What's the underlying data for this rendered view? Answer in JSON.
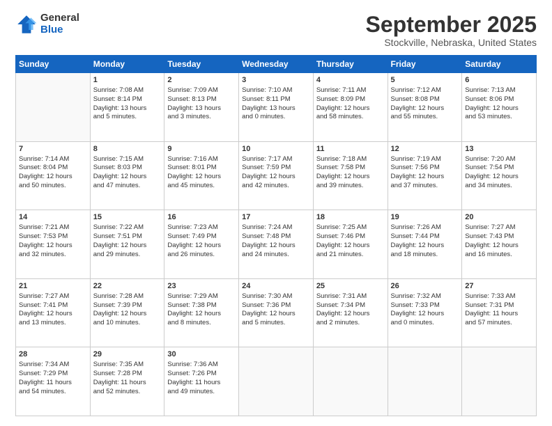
{
  "logo": {
    "general": "General",
    "blue": "Blue"
  },
  "header": {
    "month": "September 2025",
    "location": "Stockville, Nebraska, United States"
  },
  "days_of_week": [
    "Sunday",
    "Monday",
    "Tuesday",
    "Wednesday",
    "Thursday",
    "Friday",
    "Saturday"
  ],
  "weeks": [
    [
      {
        "day": "",
        "content": ""
      },
      {
        "day": "1",
        "content": "Sunrise: 7:08 AM\nSunset: 8:14 PM\nDaylight: 13 hours\nand 5 minutes."
      },
      {
        "day": "2",
        "content": "Sunrise: 7:09 AM\nSunset: 8:13 PM\nDaylight: 13 hours\nand 3 minutes."
      },
      {
        "day": "3",
        "content": "Sunrise: 7:10 AM\nSunset: 8:11 PM\nDaylight: 13 hours\nand 0 minutes."
      },
      {
        "day": "4",
        "content": "Sunrise: 7:11 AM\nSunset: 8:09 PM\nDaylight: 12 hours\nand 58 minutes."
      },
      {
        "day": "5",
        "content": "Sunrise: 7:12 AM\nSunset: 8:08 PM\nDaylight: 12 hours\nand 55 minutes."
      },
      {
        "day": "6",
        "content": "Sunrise: 7:13 AM\nSunset: 8:06 PM\nDaylight: 12 hours\nand 53 minutes."
      }
    ],
    [
      {
        "day": "7",
        "content": "Sunrise: 7:14 AM\nSunset: 8:04 PM\nDaylight: 12 hours\nand 50 minutes."
      },
      {
        "day": "8",
        "content": "Sunrise: 7:15 AM\nSunset: 8:03 PM\nDaylight: 12 hours\nand 47 minutes."
      },
      {
        "day": "9",
        "content": "Sunrise: 7:16 AM\nSunset: 8:01 PM\nDaylight: 12 hours\nand 45 minutes."
      },
      {
        "day": "10",
        "content": "Sunrise: 7:17 AM\nSunset: 7:59 PM\nDaylight: 12 hours\nand 42 minutes."
      },
      {
        "day": "11",
        "content": "Sunrise: 7:18 AM\nSunset: 7:58 PM\nDaylight: 12 hours\nand 39 minutes."
      },
      {
        "day": "12",
        "content": "Sunrise: 7:19 AM\nSunset: 7:56 PM\nDaylight: 12 hours\nand 37 minutes."
      },
      {
        "day": "13",
        "content": "Sunrise: 7:20 AM\nSunset: 7:54 PM\nDaylight: 12 hours\nand 34 minutes."
      }
    ],
    [
      {
        "day": "14",
        "content": "Sunrise: 7:21 AM\nSunset: 7:53 PM\nDaylight: 12 hours\nand 32 minutes."
      },
      {
        "day": "15",
        "content": "Sunrise: 7:22 AM\nSunset: 7:51 PM\nDaylight: 12 hours\nand 29 minutes."
      },
      {
        "day": "16",
        "content": "Sunrise: 7:23 AM\nSunset: 7:49 PM\nDaylight: 12 hours\nand 26 minutes."
      },
      {
        "day": "17",
        "content": "Sunrise: 7:24 AM\nSunset: 7:48 PM\nDaylight: 12 hours\nand 24 minutes."
      },
      {
        "day": "18",
        "content": "Sunrise: 7:25 AM\nSunset: 7:46 PM\nDaylight: 12 hours\nand 21 minutes."
      },
      {
        "day": "19",
        "content": "Sunrise: 7:26 AM\nSunset: 7:44 PM\nDaylight: 12 hours\nand 18 minutes."
      },
      {
        "day": "20",
        "content": "Sunrise: 7:27 AM\nSunset: 7:43 PM\nDaylight: 12 hours\nand 16 minutes."
      }
    ],
    [
      {
        "day": "21",
        "content": "Sunrise: 7:27 AM\nSunset: 7:41 PM\nDaylight: 12 hours\nand 13 minutes."
      },
      {
        "day": "22",
        "content": "Sunrise: 7:28 AM\nSunset: 7:39 PM\nDaylight: 12 hours\nand 10 minutes."
      },
      {
        "day": "23",
        "content": "Sunrise: 7:29 AM\nSunset: 7:38 PM\nDaylight: 12 hours\nand 8 minutes."
      },
      {
        "day": "24",
        "content": "Sunrise: 7:30 AM\nSunset: 7:36 PM\nDaylight: 12 hours\nand 5 minutes."
      },
      {
        "day": "25",
        "content": "Sunrise: 7:31 AM\nSunset: 7:34 PM\nDaylight: 12 hours\nand 2 minutes."
      },
      {
        "day": "26",
        "content": "Sunrise: 7:32 AM\nSunset: 7:33 PM\nDaylight: 12 hours\nand 0 minutes."
      },
      {
        "day": "27",
        "content": "Sunrise: 7:33 AM\nSunset: 7:31 PM\nDaylight: 11 hours\nand 57 minutes."
      }
    ],
    [
      {
        "day": "28",
        "content": "Sunrise: 7:34 AM\nSunset: 7:29 PM\nDaylight: 11 hours\nand 54 minutes."
      },
      {
        "day": "29",
        "content": "Sunrise: 7:35 AM\nSunset: 7:28 PM\nDaylight: 11 hours\nand 52 minutes."
      },
      {
        "day": "30",
        "content": "Sunrise: 7:36 AM\nSunset: 7:26 PM\nDaylight: 11 hours\nand 49 minutes."
      },
      {
        "day": "",
        "content": ""
      },
      {
        "day": "",
        "content": ""
      },
      {
        "day": "",
        "content": ""
      },
      {
        "day": "",
        "content": ""
      }
    ]
  ]
}
